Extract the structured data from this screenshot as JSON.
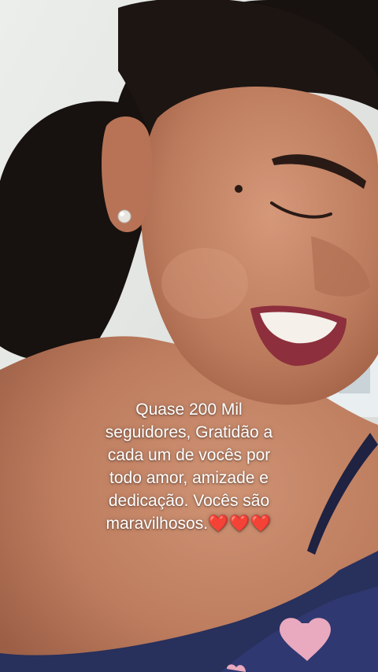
{
  "story": {
    "caption": "Quase 200 Mil\nseguidores, Gratidão a\ncada um de vocês por\ntodo amor, amizade e\ndedicação. Vocês são\nmaravilhosos.",
    "emoji": "❤️❤️❤️"
  },
  "icons": [
    "heart-emoji-icon"
  ],
  "colors": {
    "wall": "#e4e5e3",
    "hair": "#17110f",
    "skin": "#c07f62",
    "lips": "#8d2f3c",
    "top": "#28305c",
    "heart_print": "#e9a9be",
    "caption_text": "#ffffff",
    "emoji_heart": "#e0152e"
  }
}
